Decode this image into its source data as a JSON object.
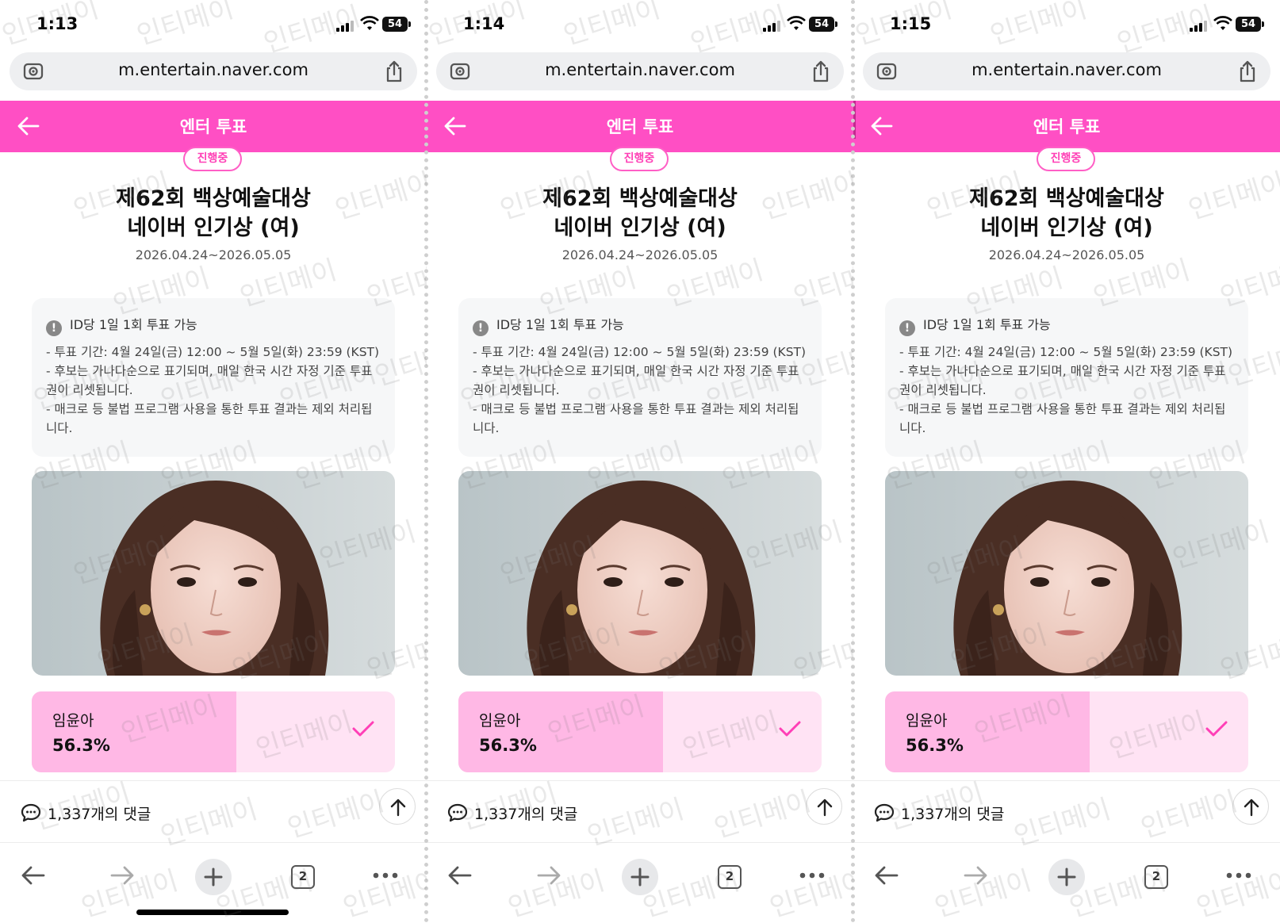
{
  "screens": [
    {
      "time": "1:13",
      "battery": "54",
      "home_indicator": true
    },
    {
      "time": "1:14",
      "battery": "54",
      "home_indicator": false
    },
    {
      "time": "1:15",
      "battery": "54",
      "home_indicator": false
    }
  ],
  "browser": {
    "url": "m.entertain.naver.com",
    "tab_count": "2"
  },
  "header": {
    "title": "엔터 투표"
  },
  "vote": {
    "status_badge": "진행중",
    "title_line1": "제62회 백상예술대상",
    "title_line2": "네이버 인기상 (여)",
    "period": "2026.04.24~2026.05.05",
    "notice_head": "ID당 1일 1회 투표 가능",
    "notice_lines": [
      "- 투표 기간: 4월 24일(금) 12:00 ~ 5월 5일(화) 23:59 (KST)",
      "- 후보는 가나다순으로 표기되며, 매일 한국 시간 자정 기준 투표",
      "권이 리셋됩니다.",
      "- 매크로 등 불법 프로그램 사용을 통한 투표 결과는 제외 처리됩",
      "니다."
    ],
    "candidate": {
      "name": "임윤아",
      "percent_label": "56.3%",
      "percent_value": 56.3,
      "selected": true
    }
  },
  "comments": {
    "label": "1,337개의 댓글"
  },
  "watermark": {
    "text": "인티메이"
  },
  "colors": {
    "accent": "#ff4fc4",
    "fill": "#ffb8e5",
    "track": "#ffe3f4",
    "check": "#ff3fb6"
  },
  "icons": [
    "camera-scan-icon",
    "share-icon",
    "back-arrow-icon",
    "info-icon",
    "check-icon",
    "comment-bubble-icon",
    "arrow-up-icon",
    "forward-arrow-icon",
    "plus-icon",
    "tabs-icon",
    "more-icon",
    "signal-icon",
    "wifi-icon",
    "battery-icon"
  ]
}
